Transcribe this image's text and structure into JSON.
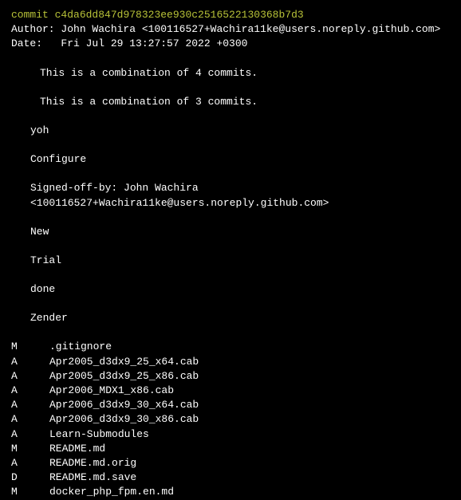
{
  "commit": {
    "label": "commit",
    "hash": "c4da6dd847d978323ee930c2516522130368b7d3"
  },
  "author": {
    "label": "Author:",
    "value": "John Wachira <100116527+Wachira11ke@users.noreply.github.com>"
  },
  "date": {
    "label": "Date:",
    "value": "Fri Jul 29 13:27:57 2022 +0300"
  },
  "messages": {
    "m0": "This is a combination of 4 commits.",
    "m1": "This is a combination of 3 commits.",
    "m2": "yoh",
    "m3": "Configure",
    "m4": "Signed-off-by: John Wachira <100116527+Wachira11ke@users.noreply.github.com>",
    "m5": "New",
    "m6": "Trial",
    "m7": "done",
    "m8": "Zender"
  },
  "files": [
    {
      "status": "M",
      "name": ".gitignore"
    },
    {
      "status": "A",
      "name": "Apr2005_d3dx9_25_x64.cab"
    },
    {
      "status": "A",
      "name": "Apr2005_d3dx9_25_x86.cab"
    },
    {
      "status": "A",
      "name": "Apr2006_MDX1_x86.cab"
    },
    {
      "status": "A",
      "name": "Apr2006_d3dx9_30_x64.cab"
    },
    {
      "status": "A",
      "name": "Apr2006_d3dx9_30_x86.cab"
    },
    {
      "status": "A",
      "name": "Learn-Submodules"
    },
    {
      "status": "M",
      "name": "README.md"
    },
    {
      "status": "A",
      "name": "README.md.orig"
    },
    {
      "status": "D",
      "name": "README.md.save"
    },
    {
      "status": "M",
      "name": "docker_php_fpm.en.md"
    }
  ]
}
